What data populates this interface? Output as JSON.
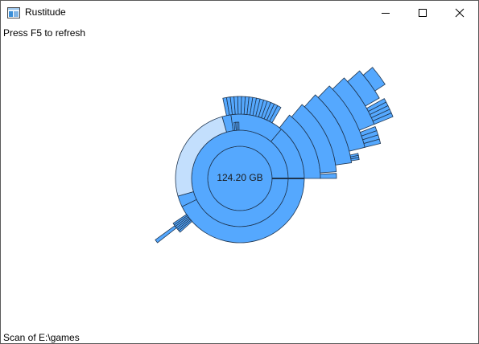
{
  "window": {
    "title": "Rustitude",
    "icon": "app-window-icon",
    "controls": [
      "minimize-icon",
      "maximize-icon",
      "close-icon"
    ]
  },
  "hint": "Press F5 to refresh",
  "chart": {
    "center_label": "124.20 GB",
    "colors": {
      "fill": "#55a8fe",
      "fill_light": "#c3dffd",
      "stroke": "#1e3550"
    }
  },
  "status_bar": {
    "text": "Scan of E:\\games"
  }
}
